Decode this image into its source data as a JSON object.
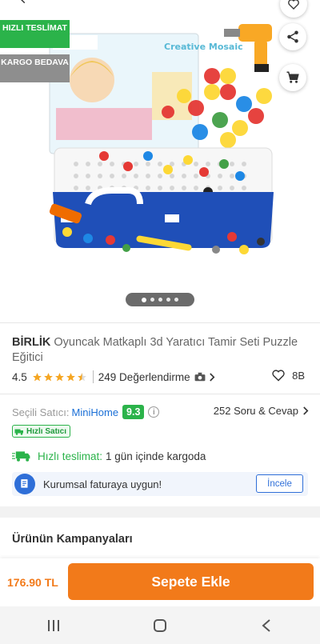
{
  "badges": {
    "fast_delivery": "HIZLI TESLİMAT",
    "free_shipping": "KARGO BEDAVA"
  },
  "product_image": {
    "box_brand": "Creative Mosaic",
    "carousel_count": 5,
    "carousel_active": 1
  },
  "product": {
    "brand": "BİRLİK",
    "name": "Oyuncak Matkaplı 3d Yaratıcı Tamir Seti Puzzle Eğitici",
    "rating": "4.5",
    "rating_value": 4.5,
    "reviews": "249 Değerlendirme",
    "favorites": "8B"
  },
  "seller": {
    "label": "Seçili Satıcı:",
    "name": "MiniHome",
    "score": "9.3",
    "info_glyph": "i",
    "qa": "252 Soru & Cevap",
    "fast_seller_badge": "Hızlı Satıcı"
  },
  "delivery": {
    "label": "Hızlı teslimat:",
    "text": "1 gün içinde kargoda"
  },
  "invoice": {
    "text": "Kurumsal faturaya uygun!",
    "button": "İncele"
  },
  "campaigns": {
    "title": "Ürünün Kampanyaları"
  },
  "bottom": {
    "price": "176.90 TL",
    "add_to_cart": "Sepete Ekle"
  },
  "colors": {
    "brand_orange": "#f27a1a",
    "success_green": "#2bb34a",
    "link_blue": "#1a6fd6",
    "badge_gray": "#8e8e8e"
  },
  "icons": [
    "back-arrow-icon",
    "favorite-heart-icon",
    "share-icon",
    "cart-icon",
    "camera-icon",
    "chevron-right-icon",
    "heart-outline-icon",
    "info-icon",
    "fast-seller-icon",
    "truck-icon",
    "invoice-icon",
    "nav-recents-icon",
    "nav-home-icon",
    "nav-back-icon"
  ]
}
